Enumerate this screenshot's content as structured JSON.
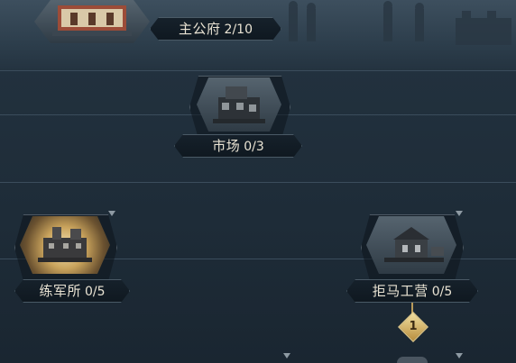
{
  "buildings": [
    {
      "name": "主公府",
      "count": "2/10"
    },
    {
      "name": "市场",
      "count": "0/3"
    },
    {
      "name": "练军所",
      "count": "0/5"
    },
    {
      "name": "拒马工营",
      "count": "0/5"
    }
  ],
  "unlock_badge": "1",
  "colors": {
    "accent_gold": "#c9a35c",
    "label_text": "#e9e3d3",
    "background": "#1e2c38"
  }
}
